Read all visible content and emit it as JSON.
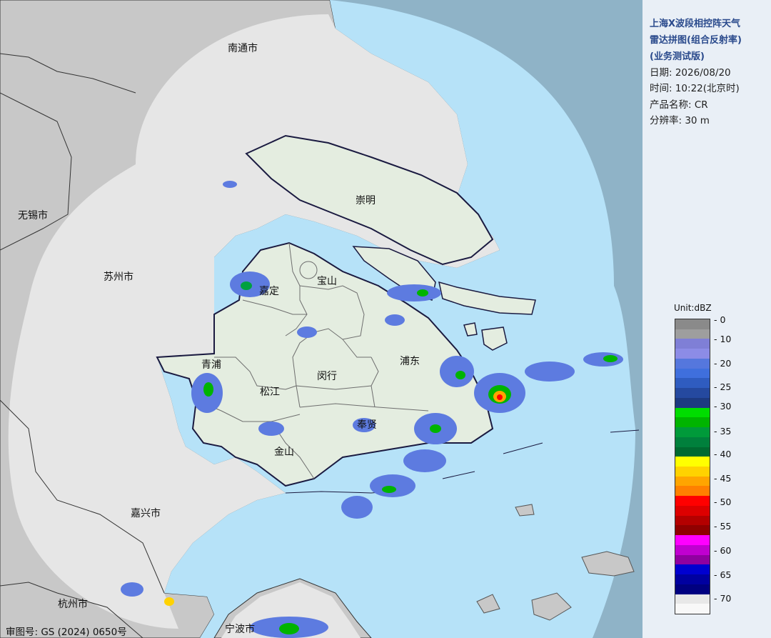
{
  "title_lines": [
    "上海X波段相控阵天气",
    "雷达拼图(组合反射率)",
    "(业务测试版)"
  ],
  "info_lines": [
    "日期: 2026/08/20",
    "时间: 10:22(北京时)",
    "产品名称: CR",
    "分辨率: 30 m"
  ],
  "legend": {
    "unit": "Unit:dBZ",
    "ticks": [
      "0",
      "10",
      "20",
      "25",
      "30",
      "35",
      "40",
      "45",
      "50",
      "55",
      "60",
      "65",
      "70"
    ],
    "colors": [
      "#8a8a8a",
      "#9e9e9e",
      "#7f7fd6",
      "#8c8ce6",
      "#5577dd",
      "#3f6fdd",
      "#2f5cc0",
      "#25499f",
      "#1d3a80",
      "#00dd00",
      "#00b400",
      "#009a3a",
      "#00803c",
      "#006a30",
      "#ffff00",
      "#ffd200",
      "#ffa500",
      "#ff8000",
      "#ff0000",
      "#dd0000",
      "#b40000",
      "#900000",
      "#ff00ff",
      "#c000d0",
      "#9000a0",
      "#0000d0",
      "#0000a0",
      "#000080",
      "#e8e8e8",
      "#f8f8f8"
    ]
  },
  "map_labels": {
    "nantong": "南通市",
    "chongming": "崇明",
    "wuxi": "无锡市",
    "suzhou": "苏州市",
    "jiading": "嘉定",
    "baoshan": "宝山",
    "qingpu": "青浦",
    "songjiang": "松江",
    "minhang": "闵行",
    "pudong": "浦东",
    "fengxian": "奉贤",
    "jinshan": "金山",
    "jiaxing": "嘉兴市",
    "hangzhou": "杭州市",
    "ningbo": "宁波市"
  },
  "caption": "审图号: GS (2024) 0650号"
}
